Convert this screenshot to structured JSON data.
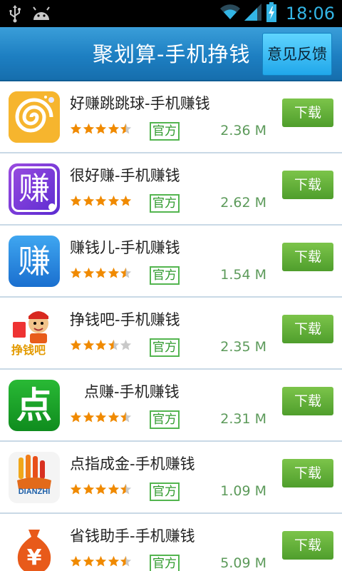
{
  "status_bar": {
    "time": "18:06",
    "left_icons": [
      "usb-icon",
      "android-icon"
    ],
    "right_icons": [
      "wifi-icon",
      "signal-icon",
      "battery-icon"
    ]
  },
  "header": {
    "title": "聚划算-手机挣钱",
    "feedback_label": "意见反馈"
  },
  "colors": {
    "header_blue": "#1d7fc2",
    "download_green": "#5faf36",
    "badge_green": "#53b54f",
    "star_orange": "#f08a00"
  },
  "apps": [
    {
      "name": "好赚跳跳球-手机赚钱",
      "rating": 4.5,
      "badge": "官方",
      "size": "2.36 M",
      "download_label": "下载",
      "icon": "swirl-ball-icon"
    },
    {
      "name": "很好赚-手机赚钱",
      "rating": 5,
      "badge": "官方",
      "size": "2.62 M",
      "download_label": "下载",
      "icon": "zhuan-purple-icon",
      "icon_text": "赚"
    },
    {
      "name": "赚钱儿-手机赚钱",
      "rating": 4.5,
      "badge": "官方",
      "size": "1.54 M",
      "download_label": "下载",
      "icon": "zhuan-blue-icon",
      "icon_text": "赚"
    },
    {
      "name": "挣钱吧-手机赚钱",
      "rating": 3.5,
      "badge": "官方",
      "size": "2.35 M",
      "download_label": "下载",
      "icon": "monkey-cartoon-icon",
      "icon_text": "挣钱吧"
    },
    {
      "name": "   点赚-手机赚钱",
      "rating": 4.5,
      "badge": "官方",
      "size": "2.31 M",
      "download_label": "下载",
      "icon": "dian-green-icon",
      "icon_text": "点"
    },
    {
      "name": "点指成金-手机赚钱",
      "rating": 4.5,
      "badge": "官方",
      "size": "1.09 M",
      "download_label": "下载",
      "icon": "dianzhi-hand-icon",
      "icon_text": "DIANZHI"
    },
    {
      "name": "省钱助手-手机赚钱",
      "rating": 4.5,
      "badge": "官方",
      "size": "5.09 M",
      "download_label": "下载",
      "icon": "money-bag-icon",
      "icon_text": "¥"
    }
  ]
}
